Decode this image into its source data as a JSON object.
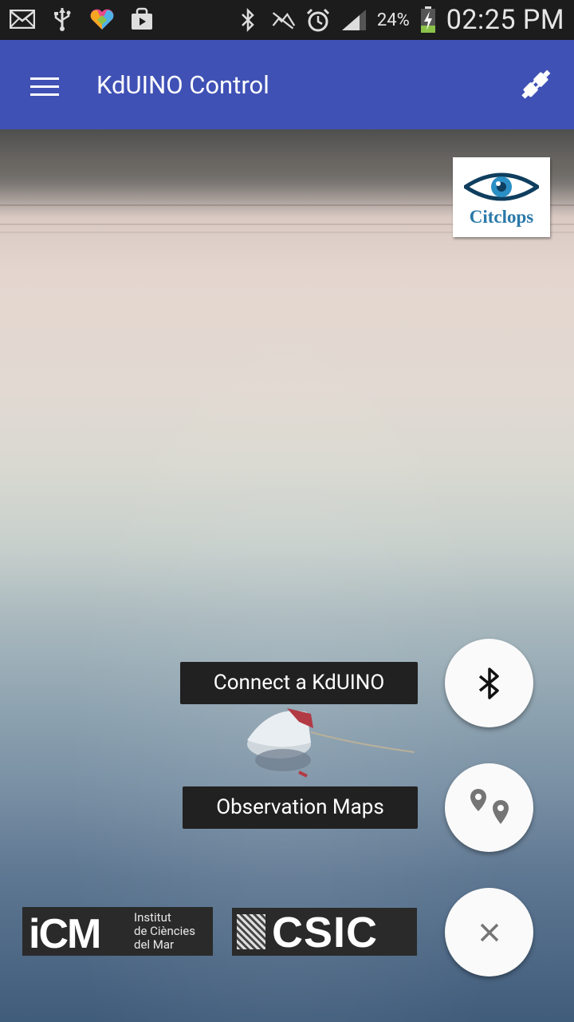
{
  "status_bar": {
    "left_icons": [
      "mail-icon",
      "usb-icon",
      "heart-app-icon",
      "store-bag-icon"
    ],
    "right_icons": [
      "bluetooth-icon",
      "mute-icon",
      "alarm-icon",
      "signal-icon"
    ],
    "battery_percent": "24%",
    "time": "02:25 PM"
  },
  "app_bar": {
    "title": "KdUINO Control",
    "color": "#3f51b5"
  },
  "logo_top": {
    "text": "Citclops"
  },
  "fab_menu": {
    "items": [
      {
        "label": "Connect a KdUINO",
        "icon": "bluetooth-icon"
      },
      {
        "label": "Observation Maps",
        "icon": "map-pins-icon"
      }
    ],
    "close_icon": "close-icon"
  },
  "footer_logos": {
    "icm": {
      "mark": "iCM",
      "line1": "Institut",
      "line2": "de Ciències",
      "line3": "del Mar"
    },
    "csic": {
      "mark": "CSIC"
    }
  }
}
